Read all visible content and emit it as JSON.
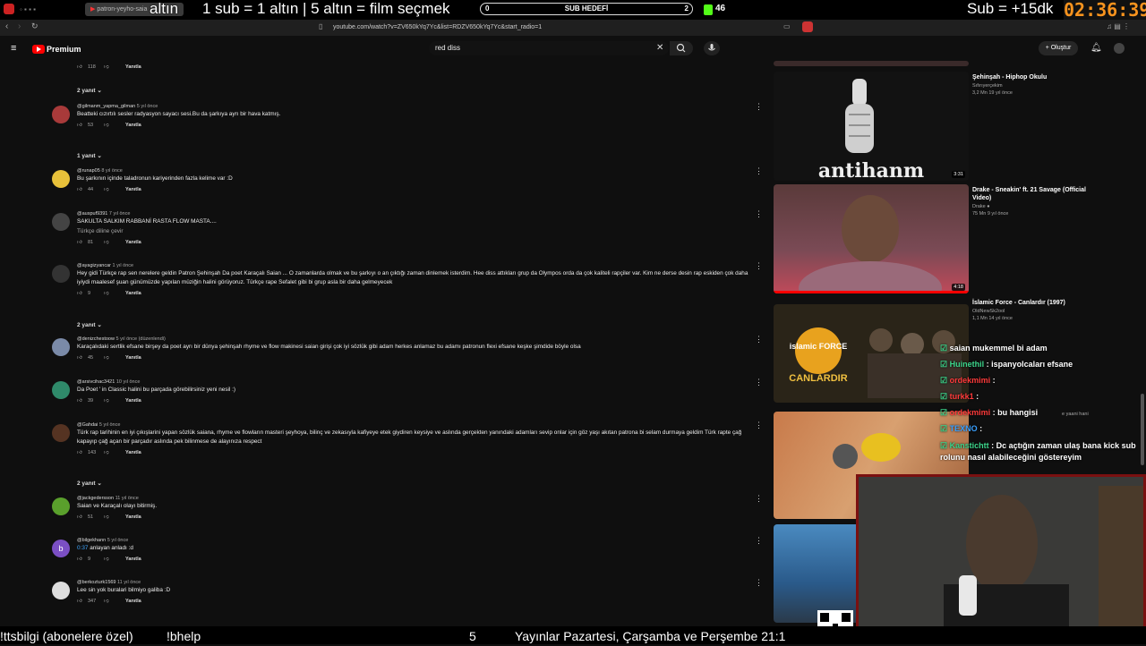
{
  "stream_overlay": {
    "top_text_left": "altın",
    "top_text_mid": "1 sub = 1 altın | 5 altın = film seçmek",
    "goal_left": "0",
    "goal_label": "SUB HEDEFİ",
    "goal_right": "2",
    "kick_count": "46",
    "top_right_text": "Sub = +15dk",
    "timer": "02:36:39",
    "bottom_left": "!ttsbilgi (abonelere özel)",
    "bottom_help": "!bhelp",
    "bottom_num": "5",
    "bottom_schedule": "Yayınlar Pazartesi, Çarşamba ve Perşembe 21:1"
  },
  "browser": {
    "tab_title": "patron-yeyho-saia",
    "url": "youtube.com/watch?v=ZV650kYq7Yc&list=RDZV650kYq7Yc&start_radio=1"
  },
  "youtube": {
    "logo_text": "Premium",
    "search_value": "red diss",
    "create_label": "Oluştur",
    "reply_label": "Yanıtla"
  },
  "comments": [
    {
      "author": "",
      "ago": "",
      "text": "",
      "likes": "118",
      "replies": "2 yanıt"
    },
    {
      "author": "@gilmanm_yapma_gilman",
      "ago": "5 yıl önce",
      "text": "Beatteki cızırtılı sesler radyasyon sayacı sesi.Bu da şarkıya ayrı bir hava katmış.",
      "likes": "53",
      "replies": "1 yanıt",
      "avatar_color": "#a83a3a"
    },
    {
      "author": "@runap05",
      "ago": "8 yıl önce",
      "text": "Bu şarkının içinde taladronun kariyerinden fazla kelime var :D",
      "likes": "44",
      "replies": "",
      "avatar_color": "#e8c13a"
    },
    {
      "author": "@auspuf9391",
      "ago": "7 yıl önce",
      "text": "SAKULTA SALKIM RABBANİ RASTA FLOW MASTA....",
      "translate": "Türkçe diline çevir",
      "likes": "81",
      "replies": "",
      "avatar_color": "#444"
    },
    {
      "author": "@ayagizyancar",
      "ago": "1 yıl önce",
      "text": "Hey gidi Türkçe rap sen nerelere geldin Patron Şehinşah Da poet Karaçalı Saian ... O zamanlarda olmak ve bu şarkıyı o an çıktığı zaman dinlemek isterdim. Hee diss attıkları grup da Olympos orda da çok kaliteli rapçiler var. Kim ne derse desin rap eskiden çok daha iyiydi maalesef şuan günümüzde yapılan müziğin halini görüyoruz. Türkçe rape Sefalet gibi bi grup asla bir daha gelmeyecek",
      "likes": "9",
      "replies": "2 yanıt",
      "avatar_color": "#333"
    },
    {
      "author": "@denizchestoow",
      "ago": "5 yıl önce (düzenlendi)",
      "text": "Karaçalıdaki sertlik efsane birşey    da poet ayrı bir dünya şehinşah rhyme ve flow makinesi   saian girişi çok iyi sözlük gibi adam  herkes anlamaz bu adamı patronun flexi efsane  keşke şimdide böyle olsa",
      "likes": "45",
      "replies": "",
      "avatar_color": "#7a8aa8"
    },
    {
      "author": "@arsivcihac3421",
      "ago": "10 yıl önce",
      "text": "Da Poet ' in Classic halini bu parçada görebilirsiniz yeni nesil :)",
      "likes": "39",
      "replies": "",
      "avatar_color": "#2f8a6a"
    },
    {
      "author": "@Gahdai",
      "ago": "5 yıl önce",
      "text": "Türk rap tarihinin en iyi çıkışlarini yapan sözlük saiana, rhyme ve flowların masteri şeyhoya, bilinç ve zekasıyla kafiyeye etek giydiren keysiye ve aslında gerçekten yanındaki adamları sevip onlar için göz yaşı akıtan patrona bi selam durmaya geldim Türk rapte çağ kapayıp çağ açan bir parçadır aslında pek bilinmese de alayınıza respect",
      "likes": "143",
      "replies": "2 yanıt",
      "avatar_color": "#553322"
    },
    {
      "author": "@jackgedersson",
      "ago": "11 yıl önce",
      "text": "Saian ve Karaçalı olayı bitirmiş.",
      "likes": "51",
      "replies": "",
      "avatar_color": "#5aa02c"
    },
    {
      "author": "@bilgekhann",
      "ago": "5 yıl önce",
      "timestamp": "0:37",
      "text": "anlayan anladı :d",
      "likes": "9",
      "replies": "",
      "avatar_color": "#7b4fc4",
      "avatar_letter": "b"
    },
    {
      "author": "@berkozturk1569",
      "ago": "11 yıl önce",
      "text": "Lee sin yok buralari bilmiyo galiba :D",
      "likes": "347",
      "replies": "",
      "avatar_color": "#ddd"
    }
  ],
  "sidebar_videos": [
    {
      "title": "Şehinşah - Hiphop Okulu",
      "channel": "Sıfırıyerçekim",
      "meta": "3,2 Mn  19 yıl önce",
      "duration": "3:31",
      "thumb_text": "antihanm"
    },
    {
      "title": "Drake - Sneakin' ft. 21 Savage (Official Video)",
      "channel": "Drake",
      "meta": "75 Mn  9 yıl önce",
      "duration": "4:18"
    },
    {
      "title": "İslamic Force - Canlardır (1997)",
      "channel": "OldNewSk2ool",
      "meta": "1,1 Mn  14 yıl önce",
      "duration": "",
      "thumb_text_top": "islamic FORCE",
      "thumb_text_bottom": "CANLARDIR"
    },
    {
      "title": "",
      "channel": "",
      "meta": "e yaani hani",
      "duration": ""
    }
  ],
  "chat": [
    {
      "user": "",
      "msg": "saian mukemmel bi adam",
      "color": "#aaaaaa"
    },
    {
      "user": "Huinethil",
      "msg": "ispanyolcaları efsane",
      "color": "#3dd68c"
    },
    {
      "user": "ordekmimi",
      "msg": "",
      "color": "#ff3b3b"
    },
    {
      "user": "turkk1",
      "msg": "",
      "color": "#ff3b3b"
    },
    {
      "user": "ordekmimi",
      "msg": "bu hangisi",
      "color": "#ff3b3b"
    },
    {
      "user": "TEXNO",
      "msg": "",
      "color": "#3aa0ff"
    },
    {
      "user": "Kanstichtt",
      "msg": "Dc açtığın zaman ulaş bana kick sub rolunu nasıl alabileceğini göstereyim",
      "color": "#3dd68c"
    }
  ],
  "colors": {
    "accent_red": "#ff0000",
    "timer": "#f7931e",
    "kick_green": "#53fc18"
  }
}
